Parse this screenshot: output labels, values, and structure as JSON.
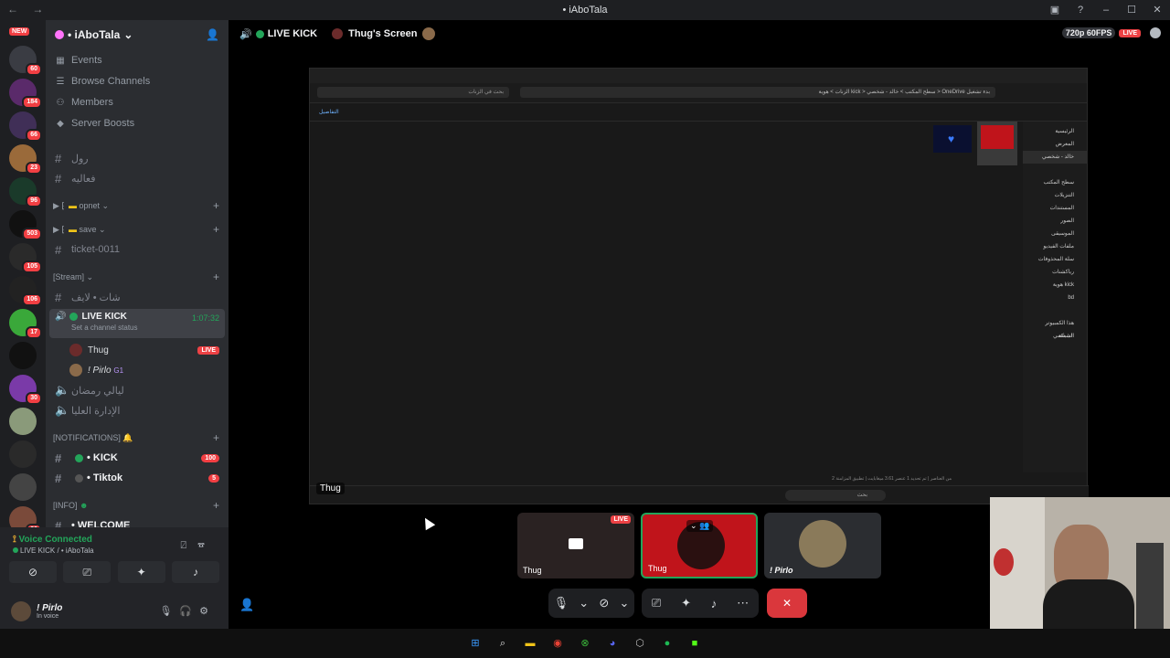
{
  "window": {
    "title": "• iAboTala",
    "nav": "← →"
  },
  "guilds": {
    "new_label": "NEW",
    "badges": [
      "60",
      "184",
      "66",
      "23",
      "96",
      "503",
      "105",
      "106",
      "17",
      "",
      "30",
      "",
      "",
      "",
      "29"
    ]
  },
  "server": {
    "name": "• iAboTala"
  },
  "menu": [
    "Events",
    "Browse Channels",
    "Members",
    "Server Boosts"
  ],
  "channels": {
    "text1": "رول",
    "text2": "فعاليه",
    "cat_opnet": "opnet",
    "cat_save": "save",
    "ticket": "ticket-0011",
    "cat_stream": "[Stream]",
    "chat_live": "شات • لايف",
    "live_kick": {
      "name": "LIVE KICK",
      "timer": "1:07:32",
      "status": "Set a channel status"
    },
    "members": [
      {
        "name": "Thug",
        "tag": "LIVE"
      },
      {
        "name": "! Pirlo",
        "tag": "G1"
      }
    ],
    "voice2": "ليالي رمضان",
    "voice3": "الإدارة العليا",
    "cat_notif": "[NOTIFICATIONS]",
    "kick": {
      "name": "• KICK",
      "badge": "100"
    },
    "tiktok": {
      "name": "• Tiktok",
      "badge": "5"
    },
    "cat_info": "[INFO]",
    "welcome": "• WELCOME"
  },
  "voice": {
    "status": "Voice Connected",
    "sub": "LIVE KICK / • iAboTala"
  },
  "user": {
    "name": "! Pirlo",
    "status": "In voice"
  },
  "stage": {
    "channel": "LIVE KICK",
    "screen": "Thug's Screen",
    "quality": "720p 60FPS",
    "live": "LIVE"
  },
  "shared_screen": {
    "path": "الزنات  >  هوية kick  >  سطح المكتب  >  خالد - شخصي  >  OneDrive بدء تشغيل",
    "search": "بحث في الزنات",
    "details": "التفاصيل",
    "nav_items": [
      "الرئيسية",
      "المعرض",
      "خالد - شخصي",
      "",
      "سطح المكتب",
      "التنزيلات",
      "المستندات",
      "الصور",
      "الموسيقى",
      "ملفات الفيديو",
      "سلة المحذوفات",
      "رياكشنات",
      "هوية kick",
      "bd",
      "",
      "هذا الكمبيوتر الشخصي",
      "الشبكة"
    ],
    "status": "2 من العناصر  |  تم تحديد 1 عنصر 3.61 ميغابايت  |  تطبيق المزامنة",
    "search_taskbar": "بحث"
  },
  "sharer_label": "Thug",
  "tiles": [
    {
      "label": "Thug",
      "live": "LIVE"
    },
    {
      "label": "Thug"
    },
    {
      "label": "! Pirlo"
    }
  ]
}
